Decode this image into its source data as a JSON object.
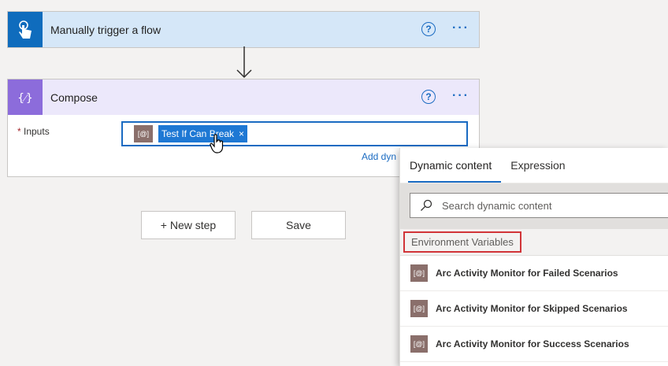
{
  "trigger": {
    "title": "Manually trigger a flow",
    "help": "?",
    "more": "···"
  },
  "compose": {
    "title": "Compose",
    "help": "?",
    "more": "···",
    "required_marker": "*",
    "inputs_label": "Inputs",
    "token_icon": "[@]",
    "token_label": "Test If Can Break",
    "token_close": "×",
    "add_dynamic_label": "Add dyn"
  },
  "actions": {
    "new_step": "+ New step",
    "save": "Save"
  },
  "panel": {
    "tabs": [
      "Dynamic content",
      "Expression"
    ],
    "search_placeholder": "Search dynamic content",
    "section_label": "Environment Variables",
    "items": [
      {
        "icon": "[@]",
        "label": "Arc Activity Monitor for Failed Scenarios"
      },
      {
        "icon": "[@]",
        "label": "Arc Activity Monitor for Skipped Scenarios"
      },
      {
        "icon": "[@]",
        "label": "Arc Activity Monitor for Success Scenarios"
      }
    ]
  },
  "colors": {
    "accent": "#1a6bc2",
    "trigger_bg": "#d5e7f8",
    "compose_bg": "#ece8fb",
    "highlight_border": "#d13438"
  }
}
